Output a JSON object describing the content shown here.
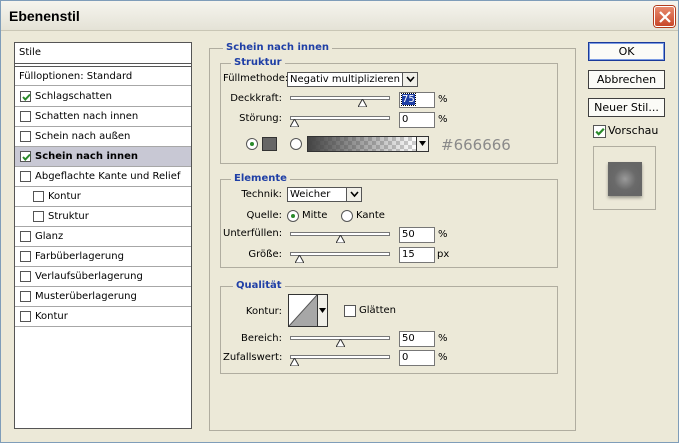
{
  "window": {
    "title": "Ebenenstil"
  },
  "stylelist": {
    "header": "Stile",
    "items": [
      {
        "label": "Fülloptionen: Standard",
        "checkbox": false,
        "indent": 0
      },
      {
        "label": "Schlagschatten",
        "checkbox": true,
        "checked": true,
        "indent": 0
      },
      {
        "label": "Schatten nach innen",
        "checkbox": true,
        "checked": false,
        "indent": 0
      },
      {
        "label": "Schein nach außen",
        "checkbox": true,
        "checked": false,
        "indent": 0
      },
      {
        "label": "Schein nach innen",
        "checkbox": true,
        "checked": true,
        "indent": 0,
        "selected": true
      },
      {
        "label": "Abgeflachte Kante und Relief",
        "checkbox": true,
        "checked": false,
        "indent": 0
      },
      {
        "label": "Kontur",
        "checkbox": true,
        "checked": false,
        "indent": 1
      },
      {
        "label": "Struktur",
        "checkbox": true,
        "checked": false,
        "indent": 1
      },
      {
        "label": "Glanz",
        "checkbox": true,
        "checked": false,
        "indent": 0
      },
      {
        "label": "Farbüberlagerung",
        "checkbox": true,
        "checked": false,
        "indent": 0
      },
      {
        "label": "Verlaufsüberlagerung",
        "checkbox": true,
        "checked": false,
        "indent": 0
      },
      {
        "label": "Musterüberlagerung",
        "checkbox": true,
        "checked": false,
        "indent": 0
      },
      {
        "label": "Kontur",
        "checkbox": true,
        "checked": false,
        "indent": 0
      }
    ]
  },
  "panel": {
    "title": "Schein nach innen",
    "structure": {
      "title": "Struktur",
      "blend_label": "Füllmethode:",
      "blend_value": "Negativ multiplizieren",
      "opacity_label": "Deckkraft:",
      "opacity_value": "75",
      "opacity_fraction": 0.75,
      "noise_label": "Störung:",
      "noise_value": "0",
      "noise_fraction": 0,
      "percent": "%",
      "color_hex": "#666666",
      "swatch_color": "#666666"
    },
    "elements": {
      "title": "Elemente",
      "technique_label": "Technik:",
      "technique_value": "Weicher",
      "source_label": "Quelle:",
      "source_center": "Mitte",
      "source_edge": "Kante",
      "choke_label": "Unterfüllen:",
      "choke_value": "50",
      "choke_fraction": 0.5,
      "size_label": "Größe:",
      "size_value": "15",
      "size_fraction": 0.06,
      "percent": "%",
      "px": "px"
    },
    "quality": {
      "title": "Qualität",
      "contour_label": "Kontur:",
      "antialias_label": "Glätten",
      "range_label": "Bereich:",
      "range_value": "50",
      "range_fraction": 0.5,
      "jitter_label": "Zufallswert:",
      "jitter_value": "0",
      "jitter_fraction": 0,
      "percent": "%"
    }
  },
  "buttons": {
    "ok": "OK",
    "cancel": "Abbrechen",
    "new_style": "Neuer Stil...",
    "preview_label": "Vorschau",
    "preview_checked": true
  },
  "colors": {
    "accent": "#1f3fa6",
    "selection": "#c8c8d4",
    "check": "#2a8a2a"
  }
}
